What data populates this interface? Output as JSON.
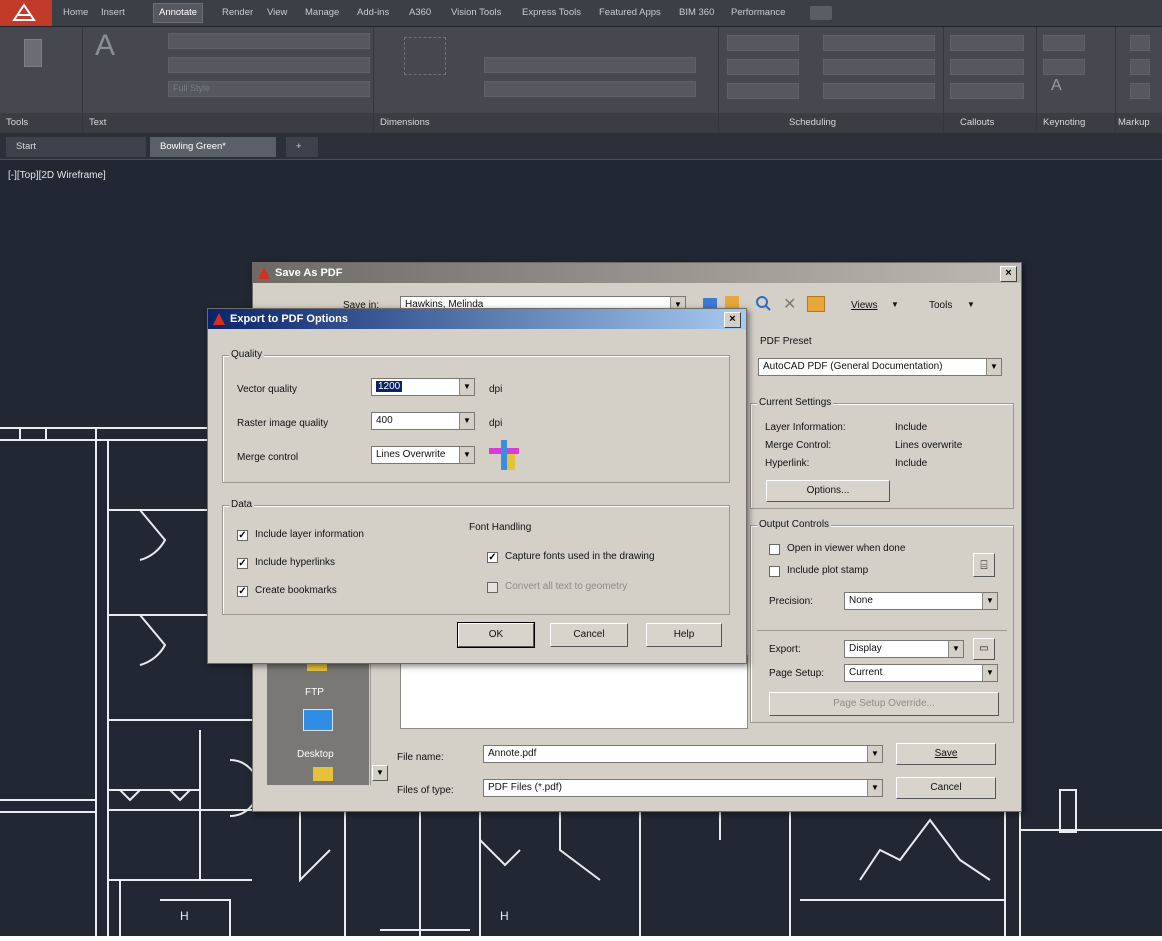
{
  "colors": {
    "accent": "#c23b2a",
    "title_bar": "#0a246a",
    "canvas": "#212833",
    "dialog": "#d4d0c8"
  },
  "ribbon": {
    "tabs": [
      "Home",
      "Insert",
      "Annotate",
      "Render",
      "View",
      "Manage",
      "Add-ins",
      "A360",
      "Vision Tools",
      "Express Tools",
      "Featured Apps",
      "BIM 360",
      "Performance"
    ],
    "active_tab": "Annotate",
    "panels": [
      "Tools",
      "Text",
      "Dimensions",
      "Scheduling",
      "Callouts",
      "Keynoting",
      "Markup"
    ],
    "text_style_value": "Full Style"
  },
  "doc_tabs": {
    "start": "Start",
    "active": "Bowling Green*",
    "new": "+"
  },
  "viewport_label": "[-][Top][2D Wireframe]",
  "save_dialog": {
    "title": "Save As PDF",
    "save_in_label": "Save in:",
    "save_in_value": "Hawkins, Melinda",
    "views_label": "Views",
    "tools_label": "Tools",
    "pdf_preset_label": "PDF Preset",
    "pdf_preset_value": "AutoCAD PDF (General Documentation)",
    "current_settings": {
      "title": "Current Settings",
      "rows": [
        {
          "label": "Layer Information:",
          "value": "Include"
        },
        {
          "label": "Merge Control:",
          "value": "Lines overwrite"
        },
        {
          "label": "Hyperlink:",
          "value": "Include"
        }
      ],
      "options_button": "Options..."
    },
    "output_controls": {
      "title": "Output Controls",
      "open_in_viewer": "Open in viewer when done",
      "include_plot_stamp": "Include plot stamp",
      "precision_label": "Precision:",
      "precision_value": "None",
      "export_label": "Export:",
      "export_value": "Display",
      "page_setup_label": "Page Setup:",
      "page_setup_value": "Current",
      "page_setup_override": "Page Setup Override..."
    },
    "places": [
      {
        "label": "FTP"
      },
      {
        "label": "Desktop"
      }
    ],
    "file_name_label": "File name:",
    "file_name_value": "Annote.pdf",
    "files_of_type_label": "Files of type:",
    "files_of_type_value": "PDF Files (*.pdf)",
    "save_button": "Save",
    "cancel_button": "Cancel"
  },
  "export_dialog": {
    "title": "Export to PDF Options",
    "quality": {
      "title": "Quality",
      "vector_label": "Vector quality",
      "vector_value": "1200",
      "raster_label": "Raster image quality",
      "raster_value": "400",
      "dpi": "dpi",
      "merge_label": "Merge control",
      "merge_value": "Lines Overwrite"
    },
    "data": {
      "title": "Data",
      "include_layer": "Include layer information",
      "include_hyperlinks": "Include hyperlinks",
      "create_bookmarks": "Create bookmarks",
      "font_handling": "Font Handling",
      "capture_fonts": "Capture fonts used in the drawing",
      "convert_text": "Convert all text to geometry"
    },
    "ok_button": "OK",
    "cancel_button": "Cancel",
    "help_button": "Help"
  }
}
